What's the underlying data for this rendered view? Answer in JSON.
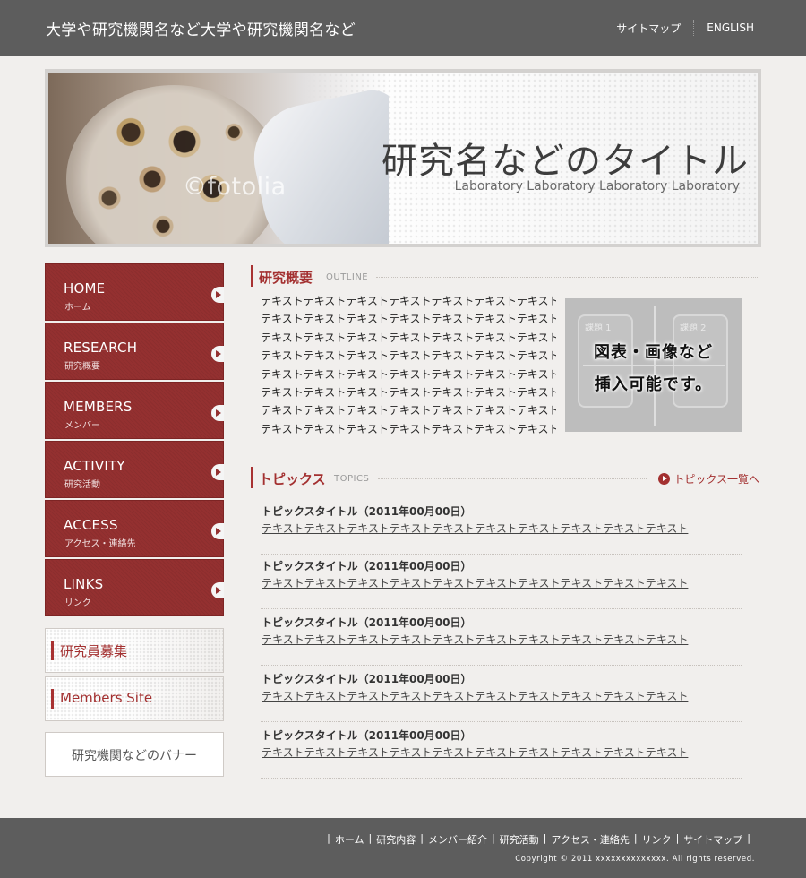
{
  "header": {
    "site_title": "大学や研究機関名など大学や研究機関名など",
    "nav": [
      "サイトマップ",
      "ENGLISH"
    ]
  },
  "hero": {
    "title": "研究名などのタイトル",
    "subtitle": "Laboratory Laboratory Laboratory Laboratory",
    "watermark": "©fotolia"
  },
  "sidebar": {
    "items": [
      {
        "en": "HOME",
        "jp": "ホーム"
      },
      {
        "en": "RESEARCH",
        "jp": "研究概要"
      },
      {
        "en": "MEMBERS",
        "jp": "メンバー"
      },
      {
        "en": "ACTIVITY",
        "jp": "研究活動"
      },
      {
        "en": "ACCESS",
        "jp": "アクセス・連絡先"
      },
      {
        "en": "LINKS",
        "jp": "リンク"
      }
    ],
    "banners": [
      "研究員募集",
      "Members Site",
      "研究機関などのバナー"
    ]
  },
  "outline": {
    "heading_jp": "研究概要",
    "heading_en": "OUTLINE",
    "lines": [
      "テキストテキストテキストテキストテキストテキストテキスト",
      "テキストテキストテキストテキストテキストテキストテキスト",
      "テキストテキストテキストテキストテキストテキストテキスト",
      "テキストテキストテキストテキストテキストテキストテキスト",
      "テキストテキストテキストテキストテキストテキストテキスト",
      "テキストテキストテキストテキストテキストテキストテキスト",
      "テキストテキストテキストテキストテキストテキストテキスト",
      "テキストテキストテキストテキストテキストテキストテキスト"
    ],
    "figure": {
      "caption_line1": "図表・画像など",
      "caption_line2": "挿入可能です。",
      "box1": "課題 1",
      "box2": "課題 2"
    }
  },
  "topics": {
    "heading_jp": "トピックス",
    "heading_en": "TOPICS",
    "list_link": "トピックス一覧へ",
    "items": [
      {
        "title": "トピックスタイトル（2011年00月00日）",
        "text": "テキストテキストテキストテキストテキストテキストテキストテキストテキストテキスト"
      },
      {
        "title": "トピックスタイトル（2011年00月00日）",
        "text": "テキストテキストテキストテキストテキストテキストテキストテキストテキストテキスト"
      },
      {
        "title": "トピックスタイトル（2011年00月00日）",
        "text": "テキストテキストテキストテキストテキストテキストテキストテキストテキストテキスト"
      },
      {
        "title": "トピックスタイトル（2011年00月00日）",
        "text": "テキストテキストテキストテキストテキストテキストテキストテキストテキストテキスト"
      },
      {
        "title": "トピックスタイトル（2011年00月00日）",
        "text": "テキストテキストテキストテキストテキストテキストテキストテキストテキストテキスト"
      }
    ]
  },
  "footer": {
    "nav": [
      "ホーム",
      "研究内容",
      "メンバー紹介",
      "研究活動",
      "アクセス・連絡先",
      "リンク",
      "サイトマップ"
    ],
    "copyright": "Copyright © 2011 xxxxxxxxxxxxxx. All rights reserved."
  },
  "colors": {
    "accent": "#943030",
    "header_bg": "#5d5d5d",
    "page_bg": "#f1efed"
  }
}
